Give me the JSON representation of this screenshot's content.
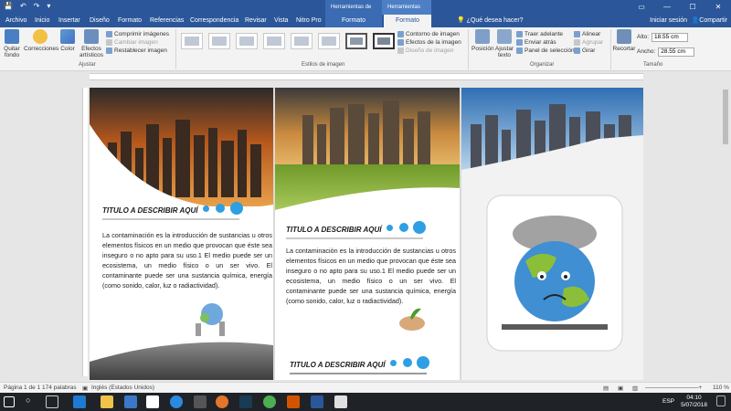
{
  "window": {
    "title": "tripti - Word",
    "quick_access": [
      "💾",
      "↶",
      "↷",
      "▾"
    ],
    "controls": [
      "▭",
      "—",
      "☐",
      "✕"
    ]
  },
  "contextual_headers": {
    "drawing": "Herramientas de dibujo",
    "image": "Herramientas de imagen"
  },
  "tabs": [
    "Archivo",
    "Inicio",
    "Insertar",
    "Diseño",
    "Formato",
    "Referencias",
    "Correspondencia",
    "Revisar",
    "Vista",
    "Nitro Pro",
    "Formato",
    "Formato"
  ],
  "tell_me": "¿Qué desea hacer?",
  "sign_in": "Iniciar sesión",
  "share": "Compartir",
  "ribbon": {
    "adjust": {
      "remove_bg": [
        "Quitar",
        "fondo"
      ],
      "corrections": "Correcciones",
      "color": "Color",
      "effects": [
        "Efectos",
        "artísticos"
      ],
      "compress": "Comprimir imágenes",
      "change": "Cambiar imagen",
      "reset": "Restablecer imagen",
      "label": "Ajustar"
    },
    "styles_label": "Estilos de imagen",
    "style_cmds": {
      "border": "Contorno de imagen",
      "effects": "Efectos de la imagen",
      "layout": "Diseño de imagen"
    },
    "arrange": {
      "position": "Posición",
      "wrap": [
        "Ajustar",
        "texto"
      ],
      "forward": "Traer adelante",
      "backward": "Enviar atrás",
      "pane": "Panel de selección",
      "align": "Alinear",
      "group": "Agrupar",
      "rotate": "Girar",
      "label": "Organizar"
    },
    "size": {
      "crop": "Recortar",
      "height_label": "Alto:",
      "height_value": "18.55 cm",
      "width_label": "Ancho:",
      "width_value": "28.55 cm",
      "label": "Tamaño"
    }
  },
  "document": {
    "panel1": {
      "heading": "TITULO A DESCRIBIR AQUÍ",
      "body": "La contaminación es la introducción de sustancias u otros elementos físicos en un medio que provocan que éste sea inseguro o no apto para su uso.1 El medio puede ser un ecosistema, un medio físico o un ser vivo. El contaminante puede ser una sustancia química, energía (como sonido, calor, luz o radiactividad)."
    },
    "panel2": {
      "heading": "TITULO A DESCRIBIR AQUÍ",
      "body": "La contaminación es la introducción de sustancias u otros elementos físicos en un medio que provocan que éste sea inseguro o no apto para su uso.1 El medio puede ser un ecosistema, un medio físico o un ser vivo. El contaminante puede ser una sustancia química, energía (como sonido, calor, luz o radiactividad).",
      "heading2": "TITULO A DESCRIBIR AQUÍ"
    }
  },
  "status": {
    "page": "Página 1 de 1",
    "words": "174 palabras",
    "language": "Inglés (Estados Unidos)",
    "zoom": "110 %"
  },
  "taskbar": {
    "lang": "ESP",
    "time": "04:10",
    "date": "5/07/2018"
  },
  "colors": {
    "word_blue": "#2b579a",
    "accent_dot": "#2f9fe3"
  }
}
